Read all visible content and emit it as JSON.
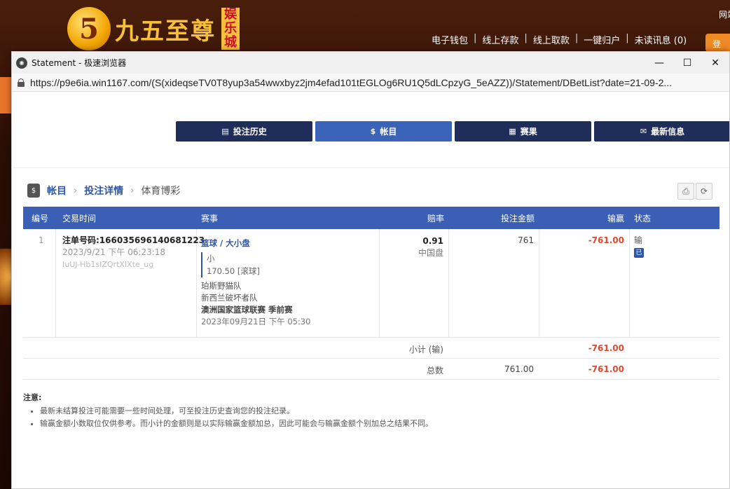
{
  "background_site": {
    "logo_digit": "5",
    "logo_text": "九五至尊",
    "logo_badge": [
      "娱",
      "乐",
      "城"
    ],
    "nav_items": [
      "电子钱包",
      "线上存款",
      "线上取款",
      "一键归户",
      "未读讯息 (0)"
    ],
    "nav_separator": "|",
    "top_right": "网站",
    "right_button": "登"
  },
  "window": {
    "title": "Statement - 极速浏览器",
    "url": "https://p9e6ia.win1167.com/(S(xideqseTV0T8yup3a54wwxbyz2jm4efad101tEGLOg6RU1Q5dLCpzyG_5eAZZ))/Statement/DBetList?date=21-09-2...",
    "controls": {
      "minimize": "—",
      "maximize": "☐",
      "close": "✕"
    }
  },
  "tabs": [
    {
      "label": "投注历史",
      "icon": "receipt-icon",
      "glyph": "▤",
      "active": false
    },
    {
      "label": "帐目",
      "icon": "ledger-icon",
      "glyph": "$",
      "active": true
    },
    {
      "label": "赛果",
      "icon": "results-icon",
      "glyph": "▦",
      "active": false
    },
    {
      "label": "最新信息",
      "icon": "mail-icon",
      "glyph": "✉",
      "active": false
    }
  ],
  "breadcrumb": {
    "icon_glyph": "$",
    "items": [
      "帐目",
      "投注详情",
      "体育博彩"
    ],
    "separator": "›"
  },
  "toolbar": {
    "print_glyph": "⎙",
    "refresh_glyph": "⟳"
  },
  "table": {
    "headers": {
      "no": "编号",
      "time": "交易时间",
      "event": "赛事",
      "odds": "赔率",
      "stake": "投注金额",
      "winloss": "输赢",
      "status": "状态"
    },
    "rows": [
      {
        "no": "1",
        "bet_id": "注单号码:166035696140681223",
        "datetime": "2023/9/21 下午 06:23:18",
        "ref": "IuUJ-Hb1sIZQrtXIXte_ug",
        "market": "篮球 / 大小盘",
        "selection": "小",
        "line": "170.50 [滚球]",
        "home": "珀斯野猫队",
        "away": "新西兰破坏者队",
        "league": "澳洲国家篮球联赛 季前赛",
        "event_time": "2023年09月21日 下午 05:30",
        "odds": "0.91",
        "odds_type": "中国盘",
        "stake": "761",
        "winloss": "-761.00",
        "status": "输",
        "status_badge": "已"
      }
    ],
    "subtotal_label": "小计 (输)",
    "subtotal_winloss": "-761.00",
    "total_label": "总数",
    "total_stake": "761.00",
    "total_winloss": "-761.00"
  },
  "notes": {
    "title": "注意:",
    "items": [
      "最新未结算投注可能需要一些时间处理，可至投注历史查询您的投注纪录。",
      "输赢金额小数取位仅供参考。而小计的金额则是以实际输赢金额加总，因此可能会与输赢金额个别加总之结果不同。"
    ]
  }
}
